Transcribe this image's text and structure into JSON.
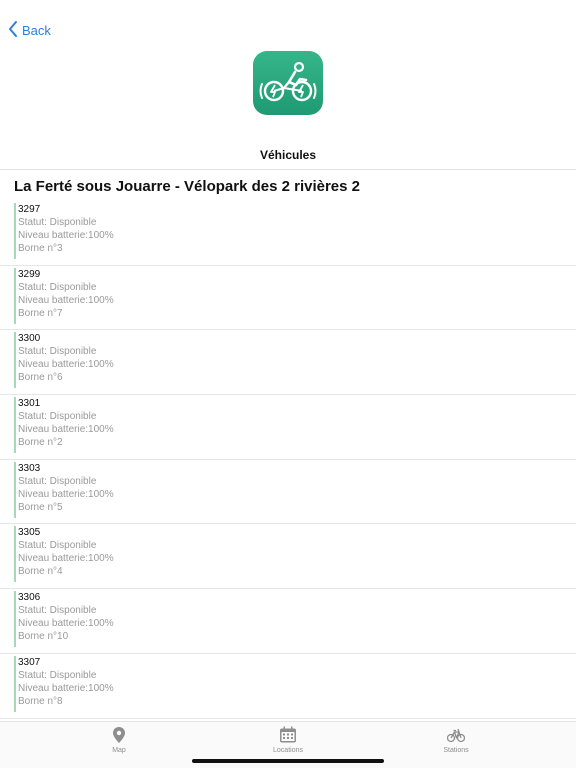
{
  "nav": {
    "back_label": "Back"
  },
  "header": {
    "title": "Véhicules"
  },
  "station": {
    "name": "La Ferté sous Jouarre - Vélopark des 2 rivières 2"
  },
  "vehicles": [
    {
      "id": "3297",
      "status": "Statut: Disponible",
      "battery": "Niveau batterie:100%",
      "dock": "Borne n°3"
    },
    {
      "id": "3299",
      "status": "Statut: Disponible",
      "battery": "Niveau batterie:100%",
      "dock": "Borne n°7"
    },
    {
      "id": "3300",
      "status": "Statut: Disponible",
      "battery": "Niveau batterie:100%",
      "dock": "Borne n°6"
    },
    {
      "id": "3301",
      "status": "Statut: Disponible",
      "battery": "Niveau batterie:100%",
      "dock": "Borne n°2"
    },
    {
      "id": "3303",
      "status": "Statut: Disponible",
      "battery": "Niveau batterie:100%",
      "dock": "Borne n°5"
    },
    {
      "id": "3305",
      "status": "Statut: Disponible",
      "battery": "Niveau batterie:100%",
      "dock": "Borne n°4"
    },
    {
      "id": "3306",
      "status": "Statut: Disponible",
      "battery": "Niveau batterie:100%",
      "dock": "Borne n°10"
    },
    {
      "id": "3307",
      "status": "Statut: Disponible",
      "battery": "Niveau batterie:100%",
      "dock": "Borne n°8"
    }
  ],
  "tabbar": {
    "map_label": "Map",
    "locations_label": "Locations",
    "stations_label": "Stations"
  },
  "colors": {
    "accent": "#2f7fd6",
    "app_icon": "#27a67c",
    "status_bar": "#a7d9b9"
  },
  "icons": {
    "back": "chevron-left-icon",
    "app": "electric-bike-icon",
    "map": "map-pin-icon",
    "locations": "calendar-icon",
    "stations": "bicycle-icon"
  }
}
